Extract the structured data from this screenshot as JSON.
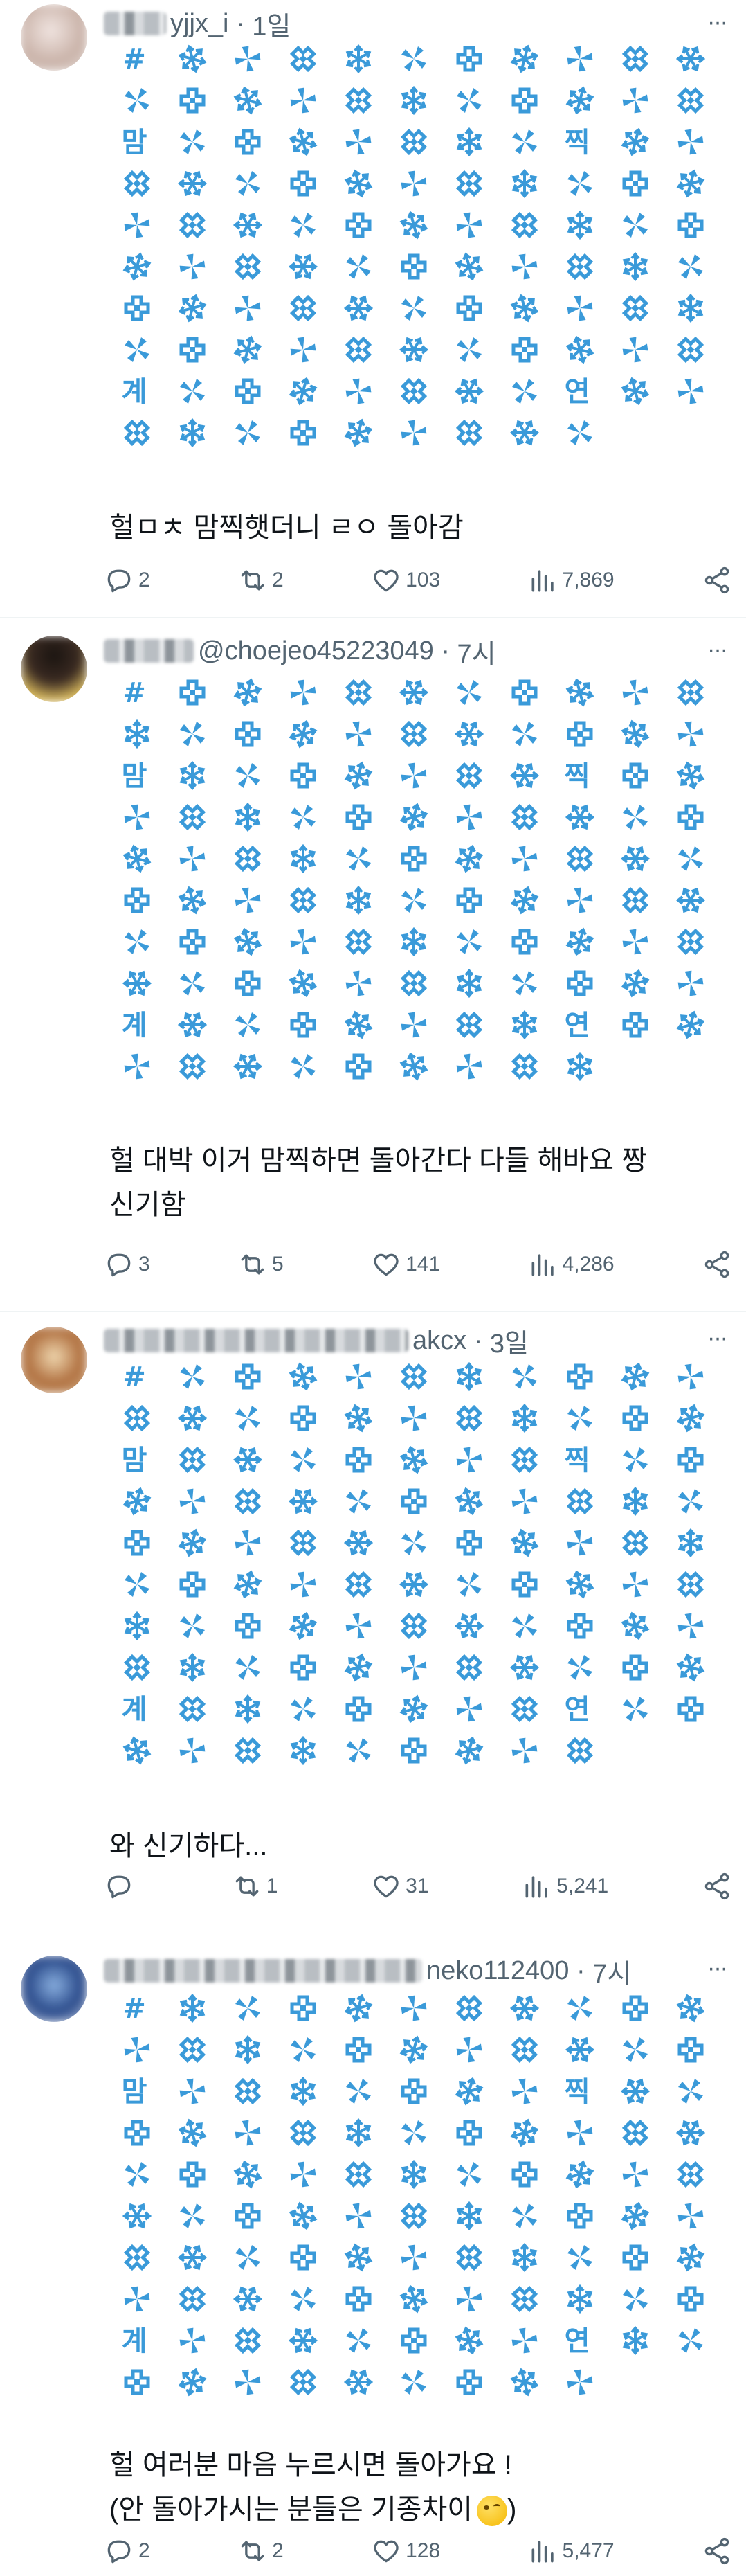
{
  "colors": {
    "pattern": "#3a9ad9",
    "meta": "#536471",
    "text": "#0f1419",
    "divider": "#eff3f4"
  },
  "pattern_labels": {
    "hash": "#",
    "mam": "맘",
    "jjik": "찍",
    "gye": "계",
    "yeon": "연"
  },
  "tweets": [
    {
      "handle": "yjjx_i",
      "time": "1일",
      "text_lines": [
        "헐ㅁㅊ 맘찍햇더니 ㄹㅇ 돌아감"
      ],
      "replies": "2",
      "retweets": "2",
      "likes": "103",
      "views": "7,869",
      "avatar_colors": [
        "#e8dcd8",
        "#c9b2a8"
      ]
    },
    {
      "handle": "@choejeo45223049",
      "time": "7시",
      "text_lines": [
        "헐 대박 이거 맘찍하면 돌아간다 다들 해바요 짱",
        "신기함"
      ],
      "replies": "3",
      "retweets": "5",
      "likes": "141",
      "views": "4,286",
      "avatar_colors": [
        "#3a2a22",
        "#e0c060"
      ]
    },
    {
      "handle": "akcx",
      "time": "3일",
      "text_lines": [
        "와 신기하다..."
      ],
      "replies": "",
      "retweets": "1",
      "likes": "31",
      "views": "5,241",
      "avatar_colors": [
        "#b07040",
        "#e8c8a0"
      ]
    },
    {
      "handle": "neko112400",
      "time": "7시",
      "text_lines": [
        "헐 여러분 마음 누르시면 돌아가요 !",
        "(안 돌아가시는 분들은 기종차이"
      ],
      "replies": "2",
      "retweets": "2",
      "likes": "128",
      "views": "5,477",
      "avatar_colors": [
        "#2a4a8a",
        "#8ab0e0"
      ]
    }
  ]
}
